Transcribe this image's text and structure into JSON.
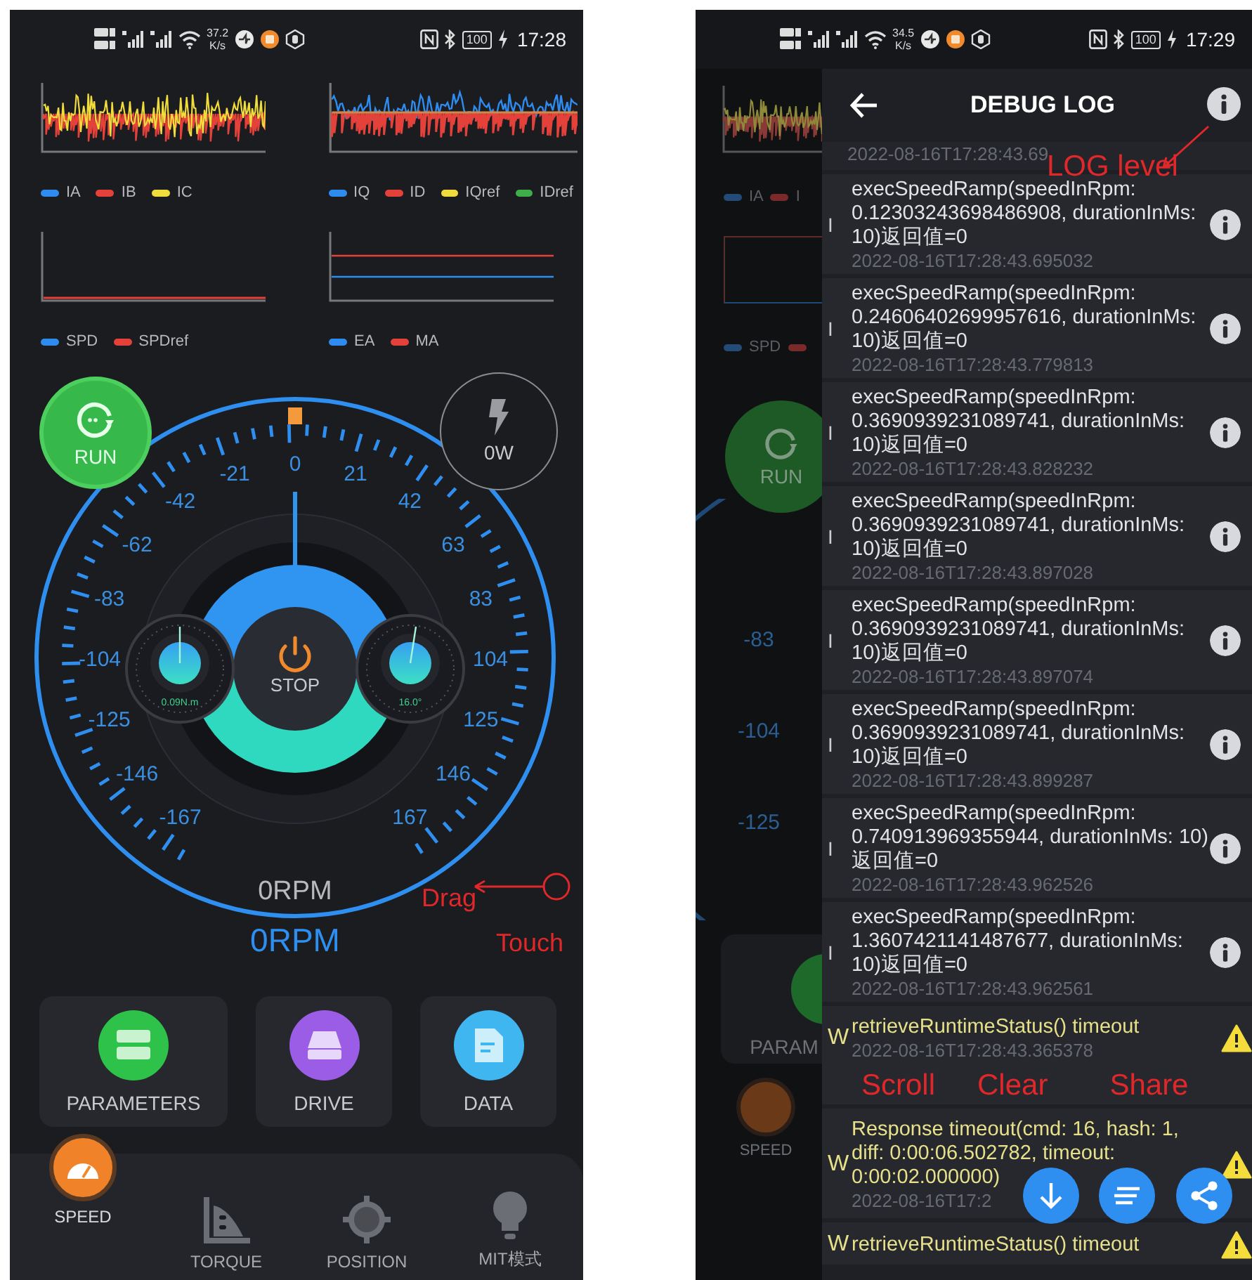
{
  "left_screen": {
    "status_bar": {
      "net_speed": "37.2",
      "net_unit": "K/s",
      "battery": "100",
      "time": "17:28"
    },
    "charts": [
      {
        "kind": "phase",
        "legend": [
          {
            "name": "IA",
            "color": "#2e8cf0"
          },
          {
            "name": "IB",
            "color": "#e5413b"
          },
          {
            "name": "IC",
            "color": "#f0dc3a"
          }
        ]
      },
      {
        "kind": "dq",
        "legend": [
          {
            "name": "IQ",
            "color": "#2e8cf0"
          },
          {
            "name": "ID",
            "color": "#e5413b"
          },
          {
            "name": "IQref",
            "color": "#f0dc3a"
          },
          {
            "name": "IDref",
            "color": "#3fae49"
          }
        ]
      },
      {
        "kind": "speed",
        "legend": [
          {
            "name": "SPD",
            "color": "#2e8cf0"
          },
          {
            "name": "SPDref",
            "color": "#e5413b"
          }
        ]
      },
      {
        "kind": "angle",
        "legend": [
          {
            "name": "EA",
            "color": "#2e8cf0"
          },
          {
            "name": "MA",
            "color": "#e5413b"
          }
        ]
      }
    ],
    "run_button": {
      "label": "RUN"
    },
    "power_button": {
      "label": "0W"
    },
    "gauge": {
      "scale": [
        "0",
        "-21",
        "21",
        "-42",
        "42",
        "-62",
        "63",
        "-83",
        "83",
        "-104",
        "104",
        "-125",
        "125",
        "-146",
        "146",
        "-167",
        "167"
      ],
      "center_label": "STOP",
      "torque_reading": "0.09N.m",
      "angle_reading": "16.0°",
      "rpm_actual": "0RPM",
      "rpm_target": "0RPM"
    },
    "cards": [
      {
        "kind": "parameters",
        "label": "PARAMETERS",
        "color": "#2fc24a"
      },
      {
        "kind": "drive",
        "label": "DRIVE",
        "color": "#9b5de5"
      },
      {
        "kind": "data",
        "label": "DATA",
        "color": "#3fb6ef"
      }
    ],
    "nav": [
      {
        "kind": "speed",
        "label": "SPEED",
        "selected": true
      },
      {
        "kind": "torque",
        "label": "TORQUE",
        "selected": false
      },
      {
        "kind": "position",
        "label": "POSITION",
        "selected": false
      },
      {
        "kind": "mit",
        "label": "MIT模式",
        "selected": false
      }
    ],
    "annotations": [
      {
        "text": "Drag"
      },
      {
        "text": "Touch"
      }
    ]
  },
  "right_screen": {
    "status_bar": {
      "net_speed": "34.5",
      "net_unit": "K/s",
      "battery": "100",
      "time": "17:29"
    },
    "background_app": {
      "legend": [
        "IA",
        "I"
      ],
      "legend_2": [
        "SPD"
      ],
      "run_label": "RUN",
      "scale": [
        "-83",
        "-104",
        "-125"
      ],
      "card_label": "PARAM",
      "nav_label": "SPEED"
    },
    "title": "DEBUG LOG",
    "first_timestamp": "2022-08-16T17:28:43.69",
    "entries": [
      {
        "level": "I",
        "kind": "info",
        "message": "execSpeedRamp(speedInRpm: 0.12303243698486908, durationInMs: 10)返回值=0",
        "timestamp": "2022-08-16T17:28:43.695032"
      },
      {
        "level": "I",
        "kind": "info",
        "message": "execSpeedRamp(speedInRpm: 0.24606402699957616, durationInMs: 10)返回值=0",
        "timestamp": "2022-08-16T17:28:43.779813"
      },
      {
        "level": "I",
        "kind": "info",
        "message": "execSpeedRamp(speedInRpm: 0.3690939231089741, durationInMs: 10)返回值=0",
        "timestamp": "2022-08-16T17:28:43.828232"
      },
      {
        "level": "I",
        "kind": "info",
        "message": "execSpeedRamp(speedInRpm: 0.3690939231089741, durationInMs: 10)返回值=0",
        "timestamp": "2022-08-16T17:28:43.897028"
      },
      {
        "level": "I",
        "kind": "info",
        "message": "execSpeedRamp(speedInRpm: 0.3690939231089741, durationInMs: 10)返回值=0",
        "timestamp": "2022-08-16T17:28:43.897074"
      },
      {
        "level": "I",
        "kind": "info",
        "message": "execSpeedRamp(speedInRpm: 0.3690939231089741, durationInMs: 10)返回值=0",
        "timestamp": "2022-08-16T17:28:43.899287"
      },
      {
        "level": "I",
        "kind": "info",
        "message": "execSpeedRamp(speedInRpm: 0.740913969355944, durationInMs: 10)返回值=0",
        "timestamp": "2022-08-16T17:28:43.962526"
      },
      {
        "level": "I",
        "kind": "info",
        "message": "execSpeedRamp(speedInRpm: 1.3607421141487677, durationInMs: 10)返回值=0",
        "timestamp": "2022-08-16T17:28:43.962561"
      },
      {
        "level": "W",
        "kind": "warning",
        "message": "retrieveRuntimeStatus() timeout",
        "timestamp": "2022-08-16T17:28:43.365378"
      },
      {
        "level": "W",
        "kind": "warning",
        "message": "Response timeout(cmd: 16, hash: 1, diff: 0:00:06.502782, timeout: 0:00:02.000000)",
        "timestamp": "2022-08-16T17:2"
      },
      {
        "level": "W",
        "kind": "warning",
        "message": "retrieveRuntimeStatus() timeout"
      }
    ],
    "annotations": [
      {
        "text": "LOG level"
      },
      {
        "text": "Scroll"
      },
      {
        "text": "Clear"
      },
      {
        "text": "Share"
      }
    ]
  }
}
